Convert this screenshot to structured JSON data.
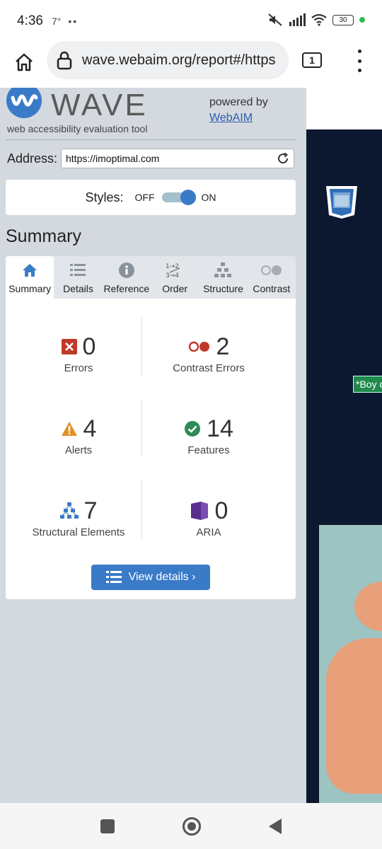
{
  "status_bar": {
    "time": "4:36",
    "temperature": "7°",
    "dots": "••",
    "battery": "30"
  },
  "browser": {
    "url": "wave.webaim.org/report#/https",
    "tab_count": "1"
  },
  "wave": {
    "logo_text": "WAVE",
    "tagline": "web accessibility evaluation tool",
    "powered_by": "powered by",
    "webaim_link": "WebAIM",
    "address_label": "Address:",
    "address_value": "https://imoptimal.com",
    "styles_label": "Styles:",
    "styles_off": "OFF",
    "styles_on": "ON",
    "summary_heading": "Summary",
    "tabs": [
      {
        "label": "Summary",
        "icon": "home-icon"
      },
      {
        "label": "Details",
        "icon": "list-icon"
      },
      {
        "label": "Reference",
        "icon": "info-icon"
      },
      {
        "label": "Order",
        "icon": "order-icon"
      },
      {
        "label": "Structure",
        "icon": "structure-icon"
      },
      {
        "label": "Contrast",
        "icon": "contrast-icon"
      }
    ],
    "stats": {
      "errors": {
        "count": "0",
        "label": "Errors"
      },
      "contrast_errors": {
        "count": "2",
        "label": "Contrast Errors"
      },
      "alerts": {
        "count": "4",
        "label": "Alerts"
      },
      "features": {
        "count": "14",
        "label": "Features"
      },
      "structural": {
        "count": "7",
        "label": "Structural Elements"
      },
      "aria": {
        "count": "0",
        "label": "ARIA"
      }
    },
    "view_details_button": "View details ›"
  },
  "site_preview": {
    "label": "*Boy c"
  },
  "colors": {
    "accent": "#3a7bc8",
    "panel_bg": "#d3d9df",
    "error_red": "#c0392b",
    "alert_orange": "#e0912a",
    "feature_green": "#2e8b57",
    "aria_purple": "#5b2d8e",
    "site_dark": "#0c1830"
  }
}
